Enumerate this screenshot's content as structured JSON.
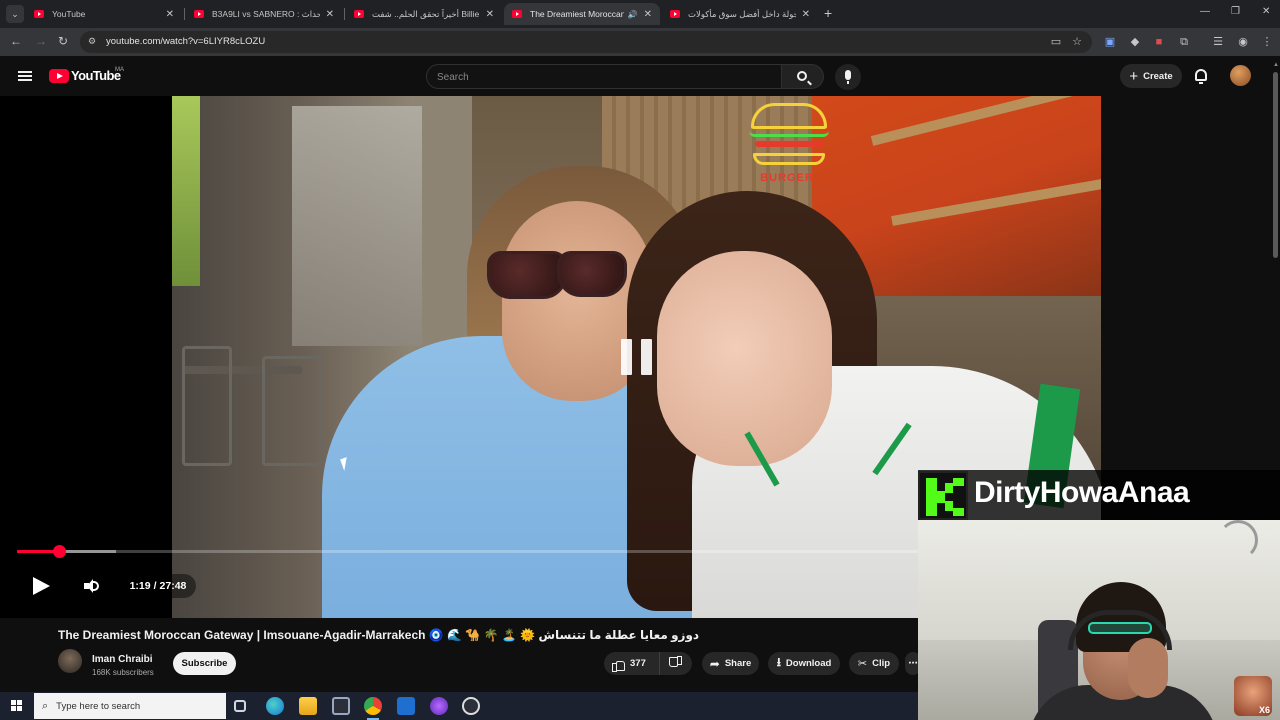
{
  "browser": {
    "tabs": [
      {
        "title": "YouTube",
        "active": false
      },
      {
        "title": "B3A9LI vs SABNERO : ح للأحداث",
        "active": false
      },
      {
        "title": "أخيراً تحقق الحلم.. شفت Billie Eilish",
        "active": false
      },
      {
        "title": "The Dreamiest Moroccan G",
        "active": true
      },
      {
        "title": "جولة داخل أفضل سوق مأكولات",
        "active": false
      }
    ],
    "url": "youtube.com/watch?v=6LIYR8cLOZU"
  },
  "masthead": {
    "logo_text": "YouTube",
    "country_code": "MA",
    "search_placeholder": "Search",
    "create_label": "Create"
  },
  "player": {
    "current_time": "1:19",
    "time_separator": "/",
    "duration": "27:48",
    "progress_fraction": 0.047,
    "buffered_fraction": 0.11,
    "state": "paused-overlay"
  },
  "video": {
    "title": "The Dreamiest Moroccan Gateway | Imsouane-Agadir-Marrakech 🧿 🌊 🐪 🌴 🏝️ 🌞 دوزو معايا عطلة ما تتنساش",
    "channel_name": "Iman Chraibi",
    "subscribers": "168K subscribers",
    "subscribe_label": "Subscribe",
    "like_count": "377",
    "share_label": "Share",
    "download_label": "Download",
    "clip_label": "Clip"
  },
  "overlay": {
    "streamer_name": "DirtyHowaAnaa",
    "platform": "kick-logo",
    "badge_text": "X6"
  },
  "scene": {
    "neon_sign_text": "BURGER"
  },
  "taskbar": {
    "search_placeholder": "Type here to search"
  },
  "colors": {
    "youtube_red": "#ff0033",
    "kick_green": "#53fc18",
    "background": "#0f0f0f"
  }
}
